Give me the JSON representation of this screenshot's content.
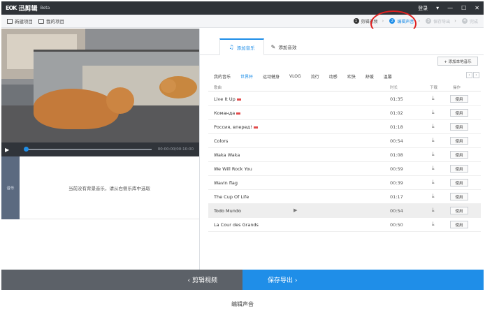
{
  "titlebar": {
    "app_name": "迅剪辑",
    "logo_mark": "EOK",
    "beta": "Beta",
    "login": "登录",
    "menu_icon": "menu-icon",
    "minimize_icon": "minimize-icon",
    "maximize_icon": "maximize-icon",
    "close_icon": "close-icon"
  },
  "toolbar": {
    "new_project": "新建项目",
    "my_projects": "我的项目",
    "steps": [
      {
        "num": "1",
        "label": "剪辑视频",
        "state": "done"
      },
      {
        "num": "2",
        "label": "编辑声音",
        "state": "active"
      },
      {
        "num": "3",
        "label": "保存导出",
        "state": "disabled"
      },
      {
        "num": "4",
        "label": "完成",
        "state": "disabled"
      }
    ],
    "step_separator": "›"
  },
  "player": {
    "play_icon": "▶",
    "time": "00:00:00/00:10:00",
    "progress": 0
  },
  "music_track": {
    "label": "音乐",
    "empty_hint": "当前没有背景音乐，请从右侧乐库中选取"
  },
  "library": {
    "tabs": [
      {
        "label": "添加音乐",
        "icon": "♫",
        "active": true
      },
      {
        "label": "添加音效",
        "icon": "✎",
        "active": false
      }
    ],
    "add_local": "+ 添加本地音乐",
    "categories": [
      "我的音乐",
      "世界杯",
      "运动健身",
      "VLOG",
      "流行",
      "动感",
      "欢快",
      "舒缓",
      "温馨"
    ],
    "active_category": "世界杯",
    "pager_prev": "‹",
    "pager_next": "›",
    "columns": {
      "name": "歌曲",
      "duration": "时长",
      "download": "下载",
      "action": "操作"
    },
    "download_icon": "⤓",
    "use_label": "使用",
    "row_play_icon": "▶",
    "rows": [
      {
        "name": "Live It Up",
        "duration": "01:35",
        "flag": true,
        "hover": false
      },
      {
        "name": "Команда",
        "duration": "01:02",
        "flag": true,
        "hover": false
      },
      {
        "name": "Россия, вперед!",
        "duration": "01:18",
        "flag": true,
        "hover": false
      },
      {
        "name": "Colors",
        "duration": "00:54",
        "flag": false,
        "hover": false
      },
      {
        "name": "Waka Waka",
        "duration": "01:08",
        "flag": false,
        "hover": false
      },
      {
        "name": "We Will Rock You",
        "duration": "00:59",
        "flag": false,
        "hover": false
      },
      {
        "name": "Wavin flag",
        "duration": "00:39",
        "flag": false,
        "hover": false
      },
      {
        "name": "The Cup Of Life",
        "duration": "01:17",
        "flag": false,
        "hover": false
      },
      {
        "name": "Todo Mundo",
        "duration": "00:54",
        "flag": false,
        "hover": true
      },
      {
        "name": "La Cour des Grands",
        "duration": "00:50",
        "flag": false,
        "hover": false
      }
    ]
  },
  "bottom": {
    "back": "‹ 剪辑视频",
    "next": "保存导出 ›"
  },
  "caption": "编辑声音",
  "colors": {
    "accent": "#1f8ee8",
    "titlebar": "#2f3338",
    "highlight_ring": "#e02020"
  }
}
